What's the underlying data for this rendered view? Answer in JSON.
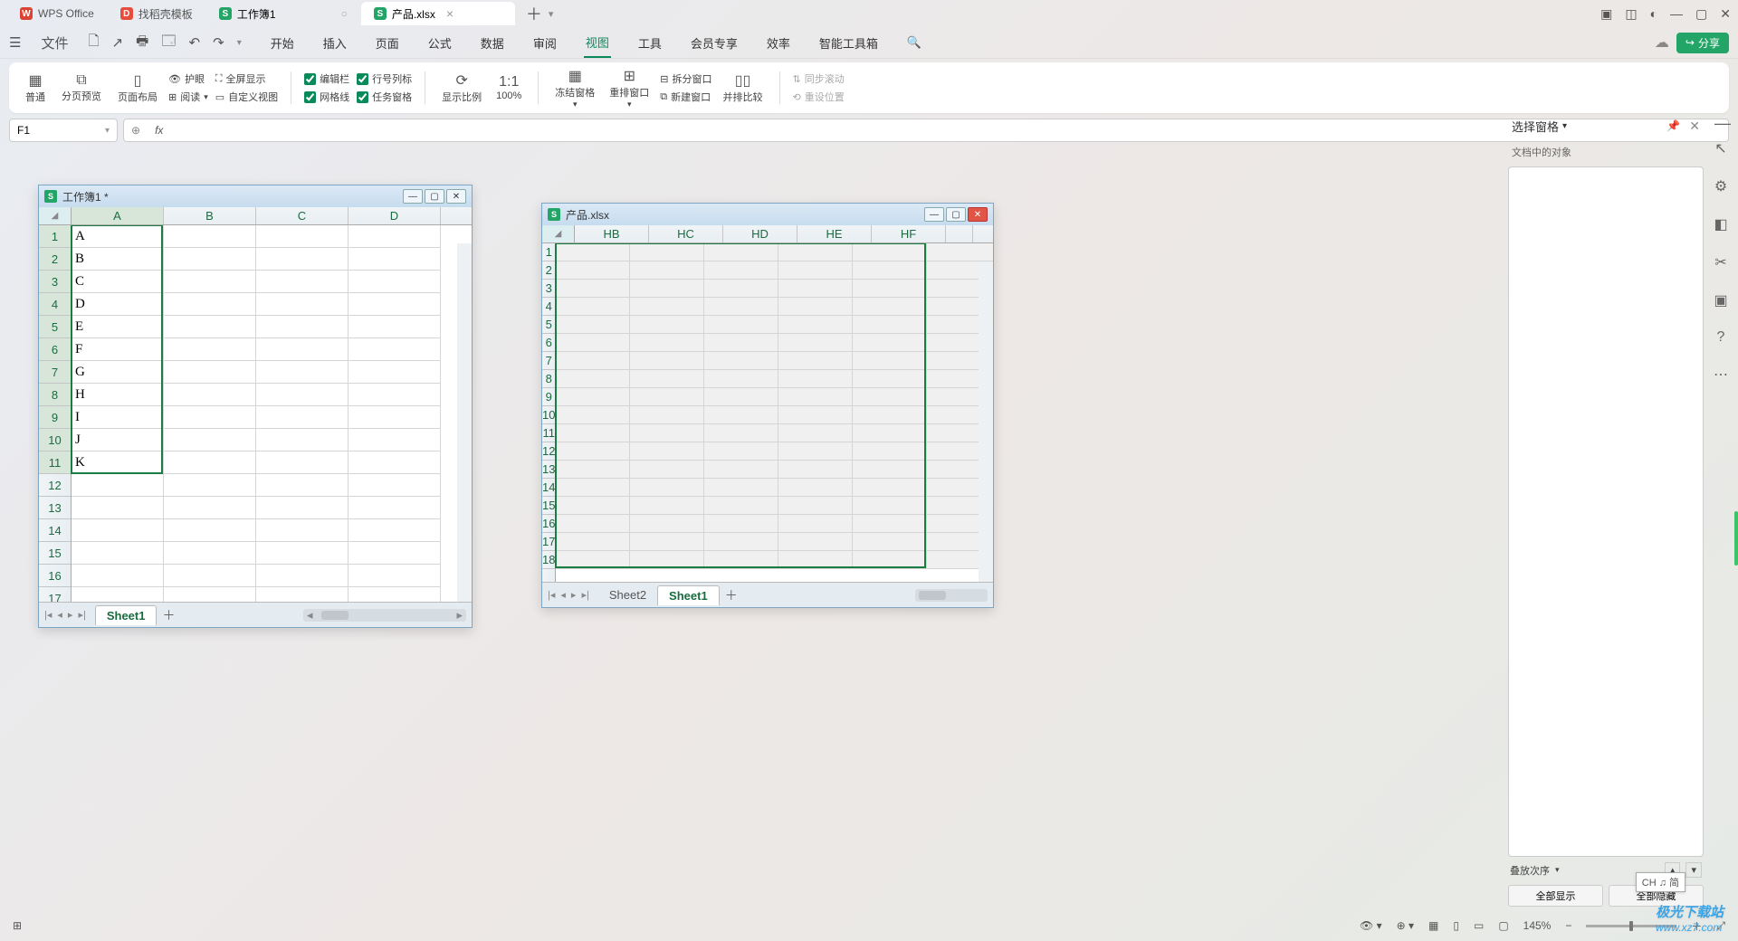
{
  "titlebar": {
    "tabs": [
      {
        "icon": "W",
        "label": "WPS Office",
        "type": "wps"
      },
      {
        "icon": "D",
        "label": "找稻壳模板",
        "type": "template"
      },
      {
        "icon": "S",
        "label": "工作簿1",
        "type": "sheet",
        "dirty": "○"
      },
      {
        "icon": "S",
        "label": "产品.xlsx",
        "type": "sheet",
        "close": "×"
      }
    ]
  },
  "menubar": {
    "file": "文件",
    "tabs": [
      "开始",
      "插入",
      "页面",
      "公式",
      "数据",
      "审阅",
      "视图",
      "工具",
      "会员专享",
      "效率",
      "智能工具箱"
    ],
    "active_index": 6,
    "share": "分享"
  },
  "ribbon": {
    "normal": "普通",
    "page_preview": "分页预览",
    "layout": "页面布局",
    "read": "阅读",
    "custom_view": "自定义视图",
    "eye": "护眼",
    "fullscreen": "全屏显示",
    "edit_bar": "编辑栏",
    "row_col": "行号列标",
    "gridlines": "网格线",
    "task_pane": "任务窗格",
    "zoom": "显示比例",
    "pct": "100%",
    "freeze": "冻结窗格",
    "rearrange": "重排窗口",
    "split": "拆分窗口",
    "new_win": "新建窗口",
    "side_by_side": "并排比较",
    "sync_scroll": "同步滚动",
    "reset_pos": "重设位置"
  },
  "formula": {
    "name_box": "F1",
    "fx": "fx"
  },
  "side": {
    "title": "选择窗格",
    "subtitle": "文档中的对象",
    "stack": "叠放次序",
    "show_all": "全部显示",
    "hide_all": "全部隐藏"
  },
  "windows": {
    "w1": {
      "title": "工作簿1 *",
      "cols": [
        "A",
        "B",
        "C",
        "D"
      ],
      "rows": 17,
      "data": [
        "A",
        "B",
        "C",
        "D",
        "E",
        "F",
        "G",
        "H",
        "I",
        "J",
        "K"
      ],
      "sheet": "Sheet1"
    },
    "w2": {
      "title": "产品.xlsx",
      "cols": [
        "HB",
        "HC",
        "HD",
        "HE",
        "HF"
      ],
      "rows": 18,
      "sheets": [
        "Sheet2",
        "Sheet1"
      ],
      "active_sheet": 1
    }
  },
  "status": {
    "zoom": "145%",
    "ime": "CH ♫ 简"
  },
  "watermark": {
    "l1": "极光下载站",
    "l2": "www.xz7.com"
  }
}
